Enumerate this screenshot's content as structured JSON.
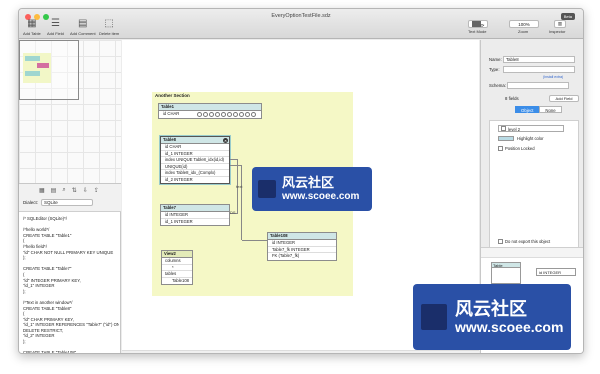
{
  "window": {
    "title": "EveryOptionTestFile.sdz"
  },
  "toolbar": {
    "add_table": "Add Table",
    "add_field": "Add Field",
    "add_comment": "Add Comment",
    "delete_item": "Delete item",
    "text_mode": "Text Mode",
    "zoom_value": "100%",
    "zoom_label": "Zoom",
    "inspector": "Inspector",
    "beta": "Beta"
  },
  "sql_panel": {
    "dialect_label": "Dialect:",
    "dialect_value": "SQLite",
    "lines": "/* SQLEditor (SQLite)*/\n\n/*hello world*/\nCREATE TABLE \"Table1\"\n(\n/*hello field*/\n\"id\" CHAR NOT NULL PRIMARY KEY UNIQUE\n);\n\nCREATE TABLE \"Table7\"\n(\n\"id\" INTEGER PRIMARY KEY,\n\"id_1\" INTEGER\n);\n\n/*Text in another window*/\nCREATE TABLE \"Table8\"\n(\n\"id\" CHAR PRIMARY KEY,\n\"id_1\" INTEGER REFERENCES \"Table7\" (\"id\") ON\nDELETE RESTRICT,\n\"id_2\" INTEGER\n);\n\nCREATE TABLE \"Table108\"\n(\n\"id\" INTEGER,"
  },
  "canvas": {
    "section_title": "Another Section",
    "table1": {
      "name": "Table1",
      "rows": [
        "id CHAR"
      ]
    },
    "table8": {
      "name": "Table8",
      "rows": [
        "id CHAR",
        "id_1 INTEGER",
        "index UNIQUE Table8_idx(id,id)",
        "UNIQUE(id)",
        "index Table8_idx_(Complx)",
        "id_2 INTEGER"
      ]
    },
    "table7": {
      "name": "Table7",
      "rows": [
        "id INTEGER",
        "id_1 INTEGER"
      ]
    },
    "table108": {
      "name": "Table108",
      "rows": [
        "id INTEGER",
        "Table7_fk INTEGER",
        "FK (Table7_fk)"
      ]
    },
    "view2": {
      "name": "View2",
      "cells": [
        "columns",
        "*",
        "tables",
        "Table108"
      ]
    },
    "edge_labels": [
      "text",
      "DS"
    ]
  },
  "inspector": {
    "name_label": "Name:",
    "name_value": "Table8",
    "type_label": "Type:",
    "type_value": "",
    "install_note": "(Install extra)",
    "schema_label": "Schema:",
    "schema_value": "",
    "fields_count": "8 fields",
    "add_field_btn": "Add Field",
    "seg_object": "Object",
    "seg_none": "None",
    "level_value": "level 2",
    "highlight_label": "Highlight color",
    "highlight_color": "#b9dbe5",
    "position_locked": "Position Locked",
    "do_not_export": "Do not export this object"
  },
  "object_library": {
    "item1_name": "Table",
    "item1_label": "Table",
    "item2_name": "id INTEGER",
    "item2_label": "Field (id INTEGER)"
  },
  "watermarks": [
    {
      "cn": "风云社区",
      "url": "www.scoee.com"
    },
    {
      "cn": "风云社区",
      "url": "www.scoee.com"
    }
  ]
}
